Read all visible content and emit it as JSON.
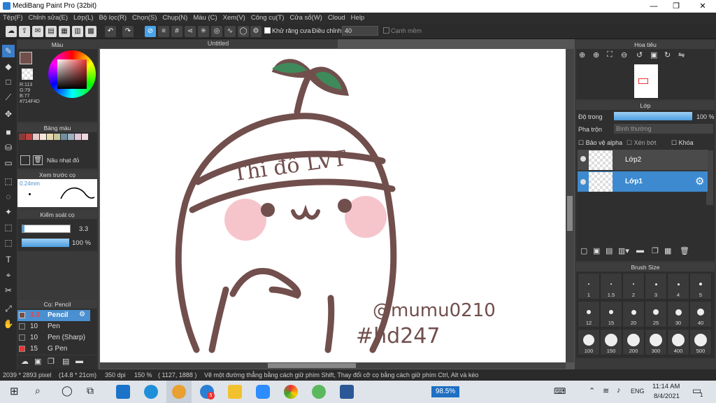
{
  "window": {
    "title": "MediBang Paint Pro (32bit)",
    "min": "—",
    "restore": "❐",
    "close": "✕"
  },
  "menu": [
    "Tệp(F)",
    "Chỉnh sửa(E)",
    "Lớp(L)",
    "Bộ lọc(R)",
    "Chọn(S)",
    "Chụp(N)",
    "Màu (C)",
    "Xem(V)",
    "Công cụ(T)",
    "Cửa sổ(W)",
    "Cloud",
    "Help"
  ],
  "toolbar": {
    "antialias_label": "Khử răng cưa",
    "adjust_label": "Điều chỉnh",
    "adjust_value": "40",
    "edge_label": "Cạnh mềm"
  },
  "color_panel": {
    "title": "Màu",
    "r": "R:113",
    "g": "G:79",
    "b": "B:77",
    "hex": "#714F4D",
    "color": "#714F4D"
  },
  "palette": {
    "title": "Bảng màu",
    "name": "Nâu nhạt đỏ",
    "swatches": [
      "#8B3A3A",
      "#C04040",
      "#E8C8C8",
      "#F5E6D6",
      "#E8D8B0",
      "#C8C8A0",
      "#7090A0",
      "#A0B0C0",
      "#E0C8D8",
      "#F0D8E0"
    ]
  },
  "brush_preview": {
    "title": "Xem trước cọ",
    "size": "0.24mm"
  },
  "brush_control": {
    "title": "Kiểm soát cọ",
    "size": "3.3",
    "opacity": "100 %"
  },
  "brush_list": {
    "title": "Cọ: Pencil",
    "items": [
      {
        "size": "3.3",
        "name": "Pencil"
      },
      {
        "size": "10",
        "name": "Pen"
      },
      {
        "size": "10",
        "name": "Pen (Sharp)"
      },
      {
        "size": "15",
        "name": "G Pen"
      }
    ]
  },
  "canvas_tab": "Untitled",
  "drawing": {
    "banner": "Thi đỗ LVT",
    "sig1": "@mumu0210",
    "sig2": "#hd247"
  },
  "navigator": {
    "title": "Hoa tiêu"
  },
  "layer_panel": {
    "title": "Lớp",
    "opacity_label": "Độ trong",
    "opacity_value": "100 %",
    "blend_label": "Pha trộn",
    "blend_value": "Bình thường",
    "protect_alpha": "Bảo vệ alpha",
    "clip": "Xén bớt",
    "lock": "Khóa",
    "layers": [
      {
        "name": "Lớp2"
      },
      {
        "name": "Lớp1"
      }
    ]
  },
  "brush_size": {
    "title": "Brush Size",
    "sizes": [
      "1",
      "1.5",
      "2",
      "3",
      "4",
      "5",
      "12",
      "15",
      "20",
      "25",
      "30",
      "40",
      "100",
      "150",
      "200",
      "300",
      "400",
      "500"
    ]
  },
  "status": {
    "pixels": "2039 * 2893 pixel",
    "cm": "(14.8 * 21cm)",
    "dpi": "350 dpi",
    "zoom": "150 %",
    "coords": "( 1127, 1888 )",
    "hint": "Vẽ một đường thẳng bằng cách giữ phím Shift, Thay đổi cỡ cọ bằng cách giữ phím Ctrl, Alt và kéo"
  },
  "taskbar": {
    "battery": "98.5%",
    "lang": "ENG",
    "time": "11:14 AM",
    "date": "8/4/2021",
    "notif": "1",
    "badge": "5"
  }
}
